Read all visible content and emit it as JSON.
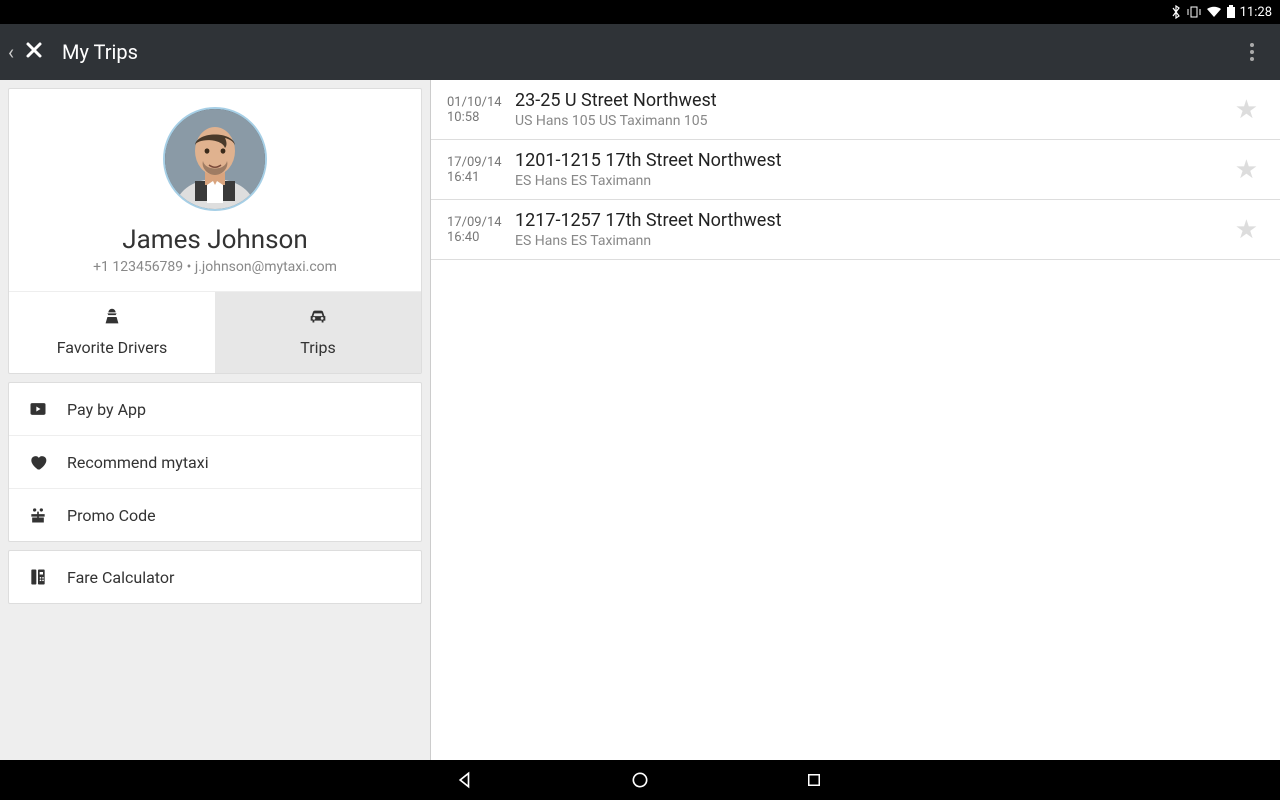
{
  "statusbar": {
    "time": "11:28"
  },
  "header": {
    "title": "My Trips"
  },
  "profile": {
    "name": "James Johnson",
    "phone": "+1 123456789",
    "email": "j.johnson@mytaxi.com"
  },
  "tabs": {
    "favorite_drivers": "Favorite Drivers",
    "trips": "Trips"
  },
  "menu": {
    "pay_by_app": "Pay by App",
    "recommend": "Recommend mytaxi",
    "promo": "Promo Code",
    "fare_calc": "Fare Calculator"
  },
  "trips": [
    {
      "date": "01/10/14",
      "time": "10:58",
      "address": "23-25 U Street Northwest",
      "driver": "US Hans 105 US Taximann 105"
    },
    {
      "date": "17/09/14",
      "time": "16:41",
      "address": "1201-1215 17th Street Northwest",
      "driver": "ES Hans ES Taximann"
    },
    {
      "date": "17/09/14",
      "time": "16:40",
      "address": "1217-1257 17th Street Northwest",
      "driver": "ES Hans ES Taximann"
    }
  ]
}
